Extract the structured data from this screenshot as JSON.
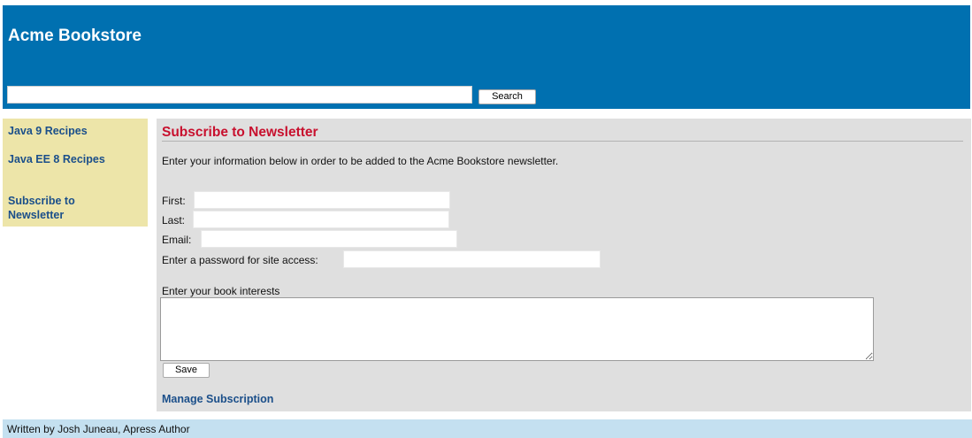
{
  "header": {
    "title": "Acme Bookstore",
    "search": {
      "value": "",
      "placeholder": "",
      "button_label": "Search"
    }
  },
  "sidebar": {
    "items": [
      {
        "label": "Java 9 Recipes"
      },
      {
        "label": "Java EE 8 Recipes"
      },
      {
        "label": "Subscribe to\nNewsletter"
      }
    ]
  },
  "main": {
    "heading": "Subscribe to Newsletter",
    "intro": "Enter your information below in order to be added to the Acme Bookstore newsletter.",
    "form": {
      "first_label": "First:",
      "first_value": "",
      "last_label": "Last:",
      "last_value": "",
      "email_label": "Email:",
      "email_value": "",
      "password_label": "Enter a password for site access:",
      "password_value": "",
      "interests_label": "Enter your book interests",
      "interests_value": "",
      "save_label": "Save"
    },
    "manage_link": "Manage Subscription"
  },
  "footer": {
    "text": "Written by Josh Juneau, Apress Author"
  },
  "colors": {
    "header_bg": "#0070b0",
    "sidebar_bg": "#ede5a9",
    "main_bg": "#dfdfdf",
    "footer_bg": "#c4e0f0",
    "heading": "#c8102e",
    "link": "#1b4f8a"
  }
}
